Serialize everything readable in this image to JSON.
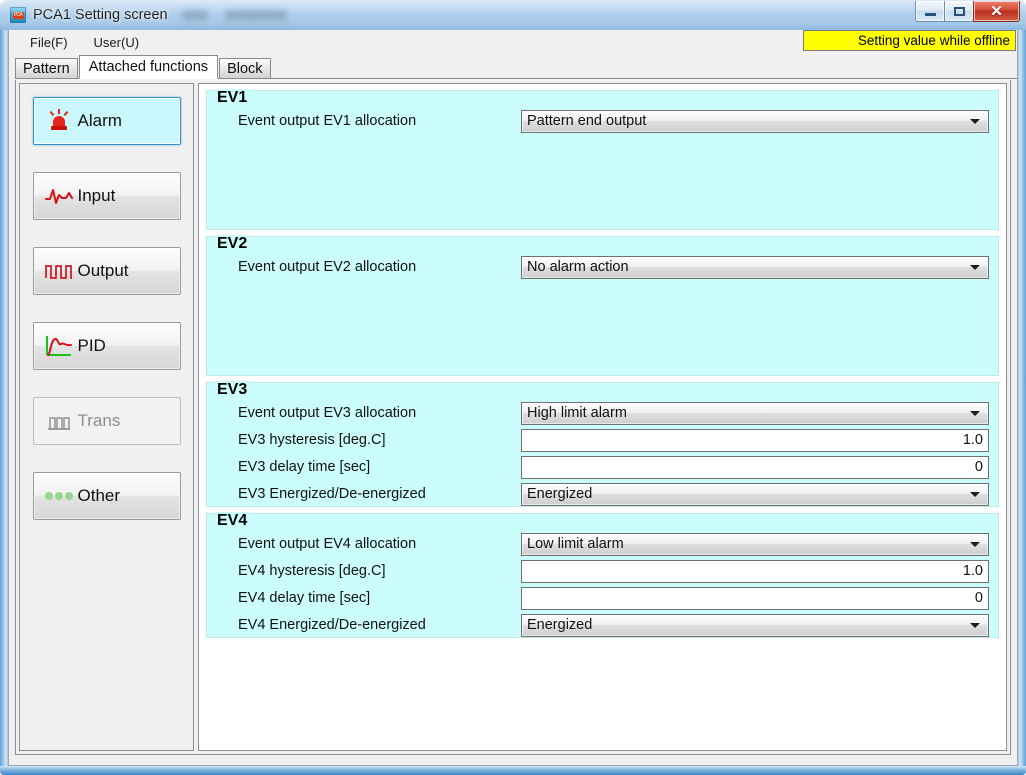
{
  "window": {
    "title": "PCA1 Setting screen",
    "icon": "app-icon",
    "controls": {
      "minimize": "minimize-icon",
      "maximize": "maximize-icon",
      "close": "close-icon"
    }
  },
  "menubar": {
    "items": [
      {
        "label": "File(F)"
      },
      {
        "label": "User(U)"
      }
    ],
    "status_banner": "Setting value while offline"
  },
  "tabs": [
    {
      "label": "Pattern",
      "active": false
    },
    {
      "label": "Attached functions",
      "active": true
    },
    {
      "label": "Block",
      "active": false
    }
  ],
  "sidebar": {
    "items": [
      {
        "label": "Alarm",
        "icon": "alarm-icon",
        "state": "selected"
      },
      {
        "label": "Input",
        "icon": "input-waveform-icon",
        "state": "normal"
      },
      {
        "label": "Output",
        "icon": "output-pulse-icon",
        "state": "normal"
      },
      {
        "label": "PID",
        "icon": "pid-curve-icon",
        "state": "normal"
      },
      {
        "label": "Trans",
        "icon": "trans-bars-icon",
        "state": "disabled"
      },
      {
        "label": "Other",
        "icon": "other-dots-icon",
        "state": "normal"
      }
    ]
  },
  "groups": [
    {
      "legend": "EV1",
      "rows": [
        {
          "label": "Event output EV1 allocation",
          "type": "combo",
          "value": "Pattern end output"
        }
      ]
    },
    {
      "legend": "EV2",
      "rows": [
        {
          "label": "Event output EV2 allocation",
          "type": "combo",
          "value": "No alarm action"
        }
      ]
    },
    {
      "legend": "EV3",
      "rows": [
        {
          "label": "Event output EV3 allocation",
          "type": "combo",
          "value": "High limit alarm"
        },
        {
          "label": "EV3 hysteresis [deg.C]",
          "type": "text",
          "value": "1.0"
        },
        {
          "label": "EV3 delay time [sec]",
          "type": "text",
          "value": "0"
        },
        {
          "label": "EV3 Energized/De-energized",
          "type": "combo",
          "value": "Energized"
        }
      ]
    },
    {
      "legend": "EV4",
      "rows": [
        {
          "label": "Event output EV4 allocation",
          "type": "combo",
          "value": "Low limit alarm"
        },
        {
          "label": "EV4 hysteresis [deg.C]",
          "type": "text",
          "value": "1.0"
        },
        {
          "label": "EV4 delay time [sec]",
          "type": "text",
          "value": "0"
        },
        {
          "label": "EV4 Energized/De-energized",
          "type": "combo",
          "value": "Energized"
        }
      ]
    }
  ],
  "colors": {
    "group_background": "#ccfdfd",
    "status_banner_background": "#ffff00",
    "selected_sidebar_background": "#c9f7fb",
    "accent_red": "#e8231c",
    "accent_green": "#22bb22"
  }
}
